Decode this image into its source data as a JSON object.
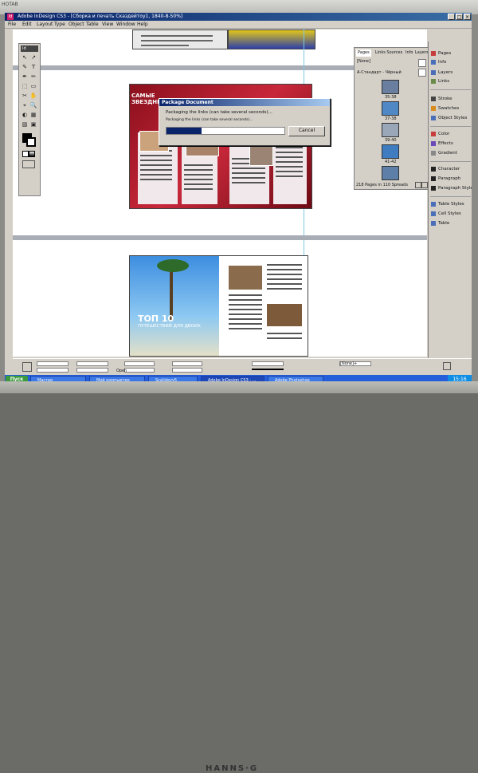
{
  "monitor": {
    "label": "HOTAB",
    "brand": "HANNS·G"
  },
  "window": {
    "title": "Adobe InDesign CS3 - [Сборка и печать Сказдейтоу1, 1840-8-50%]",
    "app_icon_text": "Id",
    "minimize": "_",
    "maximize": "□",
    "close": "×"
  },
  "menu": [
    "File",
    "Edit",
    "Layout",
    "Type",
    "Object",
    "Table",
    "View",
    "Window",
    "Help"
  ],
  "toolbox": {
    "header": "Id",
    "tools": [
      "↖",
      "↗",
      "✎",
      "T",
      "✒",
      "✏",
      "⬚",
      "▭",
      "✂",
      "✋",
      "⌖",
      "🔍",
      "◐",
      "▦",
      "▧",
      "▣"
    ]
  },
  "dialog": {
    "title": "Package Document",
    "message": "Packaging the links (can take several seconds)...",
    "submessage": "Packaging the links (can take several seconds)...",
    "cancel_label": "Cancel",
    "progress_fraction": 0.3
  },
  "pages_panel": {
    "tabs": [
      "Pages",
      "Links Sources",
      "Info",
      "Layers"
    ],
    "none_label": "[None]",
    "master_label": "А-Стандарт - Чёрный",
    "thumbs": [
      {
        "label": "35-38"
      },
      {
        "label": "37-38"
      },
      {
        "label": "39-40"
      },
      {
        "label": "41-42"
      },
      {
        "label": "43-44"
      }
    ],
    "footer": "218 Pages in 110 Spreads"
  },
  "dock": {
    "items": [
      {
        "label": "Pages",
        "color": "#c73c3c"
      },
      {
        "label": "Info",
        "color": "#4a6fb8"
      },
      {
        "label": "Layers",
        "color": "#4a6fb8"
      },
      {
        "label": "Links",
        "color": "#6a8c4a"
      },
      {
        "label": "Stroke",
        "color": "#444444"
      },
      {
        "label": "Swatches",
        "color": "#d98c1e"
      },
      {
        "label": "Object Styles",
        "color": "#4a6fb8"
      },
      {
        "label": "Color",
        "color": "#c73c3c"
      },
      {
        "label": "Effects",
        "color": "#6a4ab8"
      },
      {
        "label": "Gradient",
        "color": "#888888"
      },
      {
        "label": "Character",
        "color": "#222222"
      },
      {
        "label": "Paragraph",
        "color": "#222222"
      },
      {
        "label": "Paragraph Styles",
        "color": "#222222"
      },
      {
        "label": "Table Styles",
        "color": "#4a6fb8"
      },
      {
        "label": "Cell Styles",
        "color": "#4a6fb8"
      },
      {
        "label": "Table",
        "color": "#4a6fb8"
      }
    ]
  },
  "spreads": {
    "top_heading": "САМЫЕ ЗВЕЗДНЫЕ",
    "bottom_heading_1": "ТОП 10",
    "bottom_heading_2": "ПУТЕШЕСТВИЙ ДЛЯ ДВОИХ"
  },
  "controlbar": {
    "style_value": "[None]+",
    "open_label": "Open"
  },
  "taskbar": {
    "start": "Пуск",
    "tasks": [
      {
        "label": "Мастер",
        "active": false
      },
      {
        "label": "Мой компьютер",
        "active": false
      },
      {
        "label": "Scalidevy5",
        "active": false
      },
      {
        "label": "Adobe InDesign CS3 - ...",
        "active": true
      },
      {
        "label": "Adobe Photoshop",
        "active": false
      }
    ],
    "clock": "15:16"
  },
  "colors": {
    "titlebar": "#0a246a",
    "accent_red": "#b5172a",
    "taskbar": "#245edb"
  }
}
